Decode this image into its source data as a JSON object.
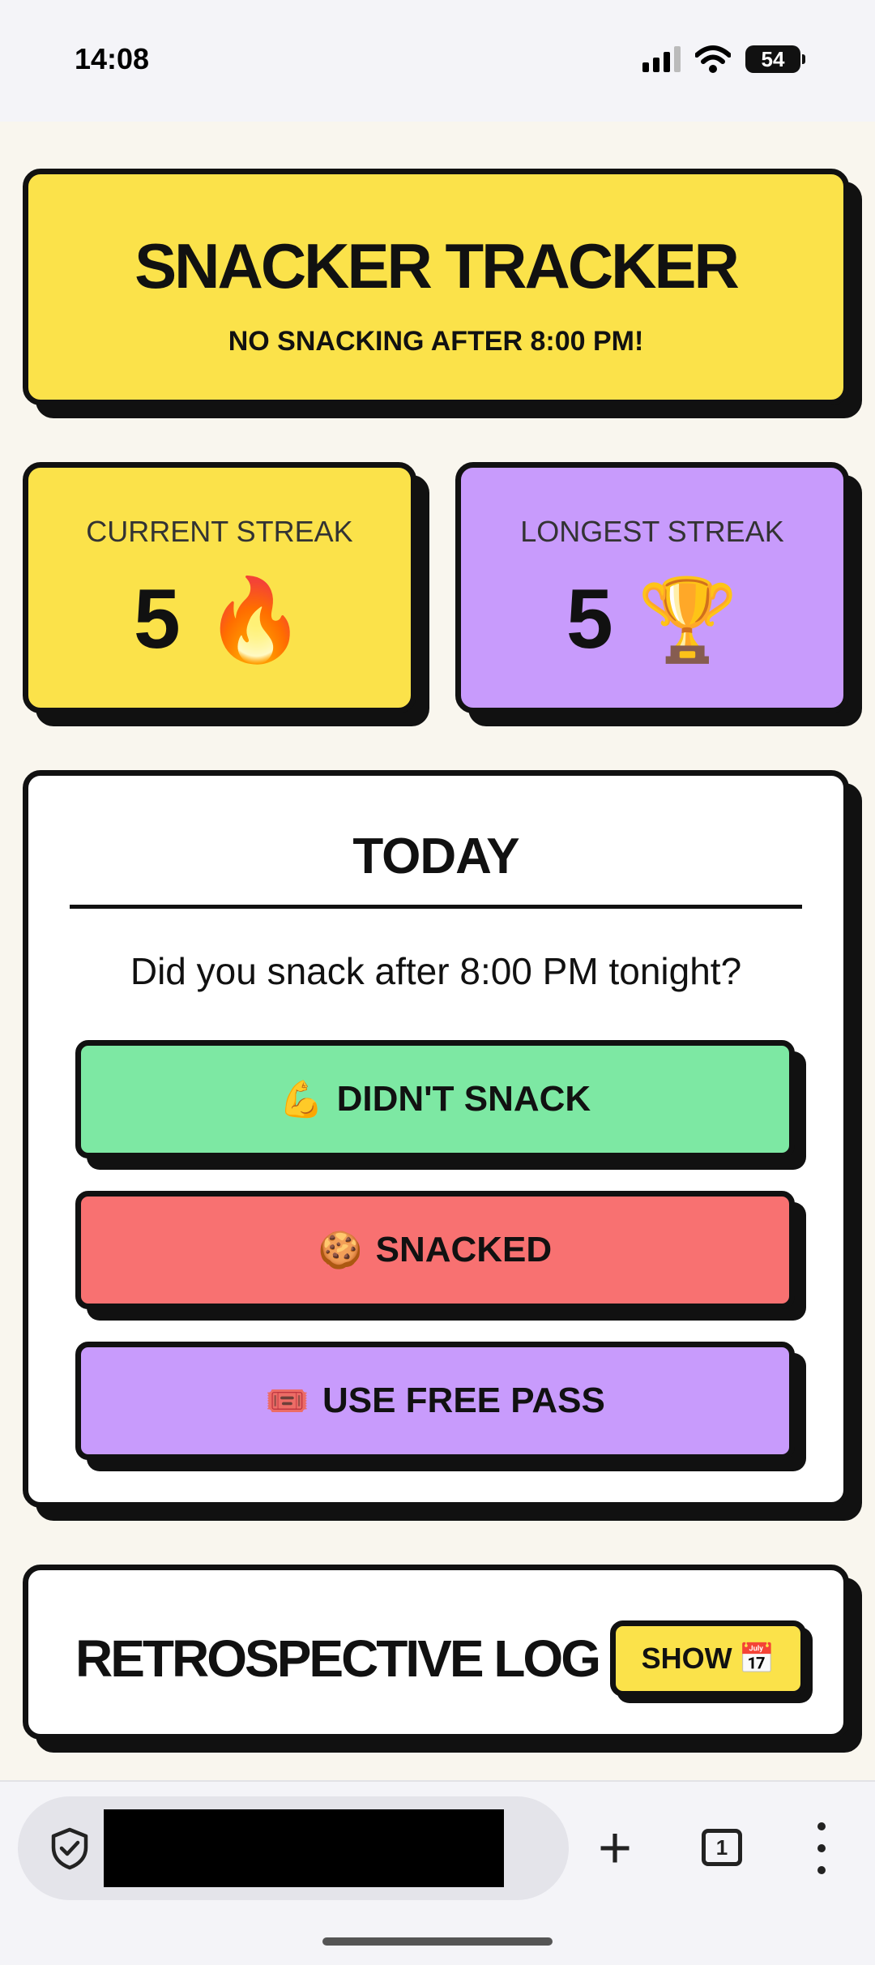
{
  "status_bar": {
    "time": "14:08",
    "battery": "54"
  },
  "header": {
    "title": "SNACKER TRACKER",
    "subtitle": "NO SNACKING AFTER 8:00 PM!"
  },
  "streaks": {
    "current": {
      "label": "CURRENT STREAK",
      "value": "5",
      "emoji": "🔥"
    },
    "longest": {
      "label": "LONGEST STREAK",
      "value": "5",
      "emoji": "🏆"
    }
  },
  "today": {
    "title": "TODAY",
    "question": "Did you snack after 8:00 PM tonight?",
    "buttons": [
      {
        "icon": "💪",
        "label": "DIDN'T SNACK",
        "color": "#7de8a3"
      },
      {
        "icon": "🍪",
        "label": "SNACKED",
        "color": "#f87171"
      },
      {
        "icon": "🎟️",
        "label": "USE FREE PASS",
        "color": "#c89bfc"
      }
    ]
  },
  "log": {
    "title": "RETROSPECTIVE LOG",
    "show_label": "SHOW",
    "show_icon": "📅"
  },
  "browser": {
    "tab_count": "1"
  },
  "colors": {
    "yellow": "#fbe24a",
    "purple": "#c89bfc",
    "green": "#7de8a3",
    "red": "#f87171",
    "ink": "#111111"
  }
}
